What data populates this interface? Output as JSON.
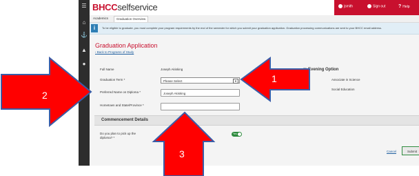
{
  "app": {
    "logo_part1": "BHCC",
    "logo_part2": "selfservice",
    "user_label": "jsmith",
    "sign_out_label": "Sign out",
    "help_label": "Help"
  },
  "tabs": [
    {
      "label": "Academics"
    },
    {
      "label": "Graduation Overview"
    }
  ],
  "info": {
    "icon_text": "i",
    "message": "To be eligible to graduate, you must complete your program requirements by the end of the semester for which you submit your graduation application. Graduation processing communications are sent to your BHCC email address."
  },
  "page": {
    "title": "Graduation Application",
    "back_link": "Back to Programs of Study"
  },
  "form": {
    "full_name_label": "Full Name",
    "full_name_value": "Joseph Akisking",
    "term_label": "Graduation Term *",
    "term_selected": "Please Select",
    "preferred_name_label": "Preferred Name on Diploma *",
    "preferred_name_value": "Joseph Akisking",
    "hometown_label": "Hometown and State/Province *",
    "hometown_value": ""
  },
  "program": {
    "header": "m Evening Option",
    "degree": "Associate in Science",
    "major": "Social Education"
  },
  "commencement": {
    "section_title": "Commencement Details",
    "pickup_question_line1": "Do you plan to pick up the",
    "pickup_question_line2": "diploma? *",
    "toggle_text": "Yes"
  },
  "actions": {
    "cancel_label": "Cancel",
    "submit_label": "Submit"
  },
  "annotations": {
    "arrow1_label": "1",
    "arrow2_label": "2",
    "arrow3_label": "3",
    "arrow_color": "#ff0000"
  }
}
